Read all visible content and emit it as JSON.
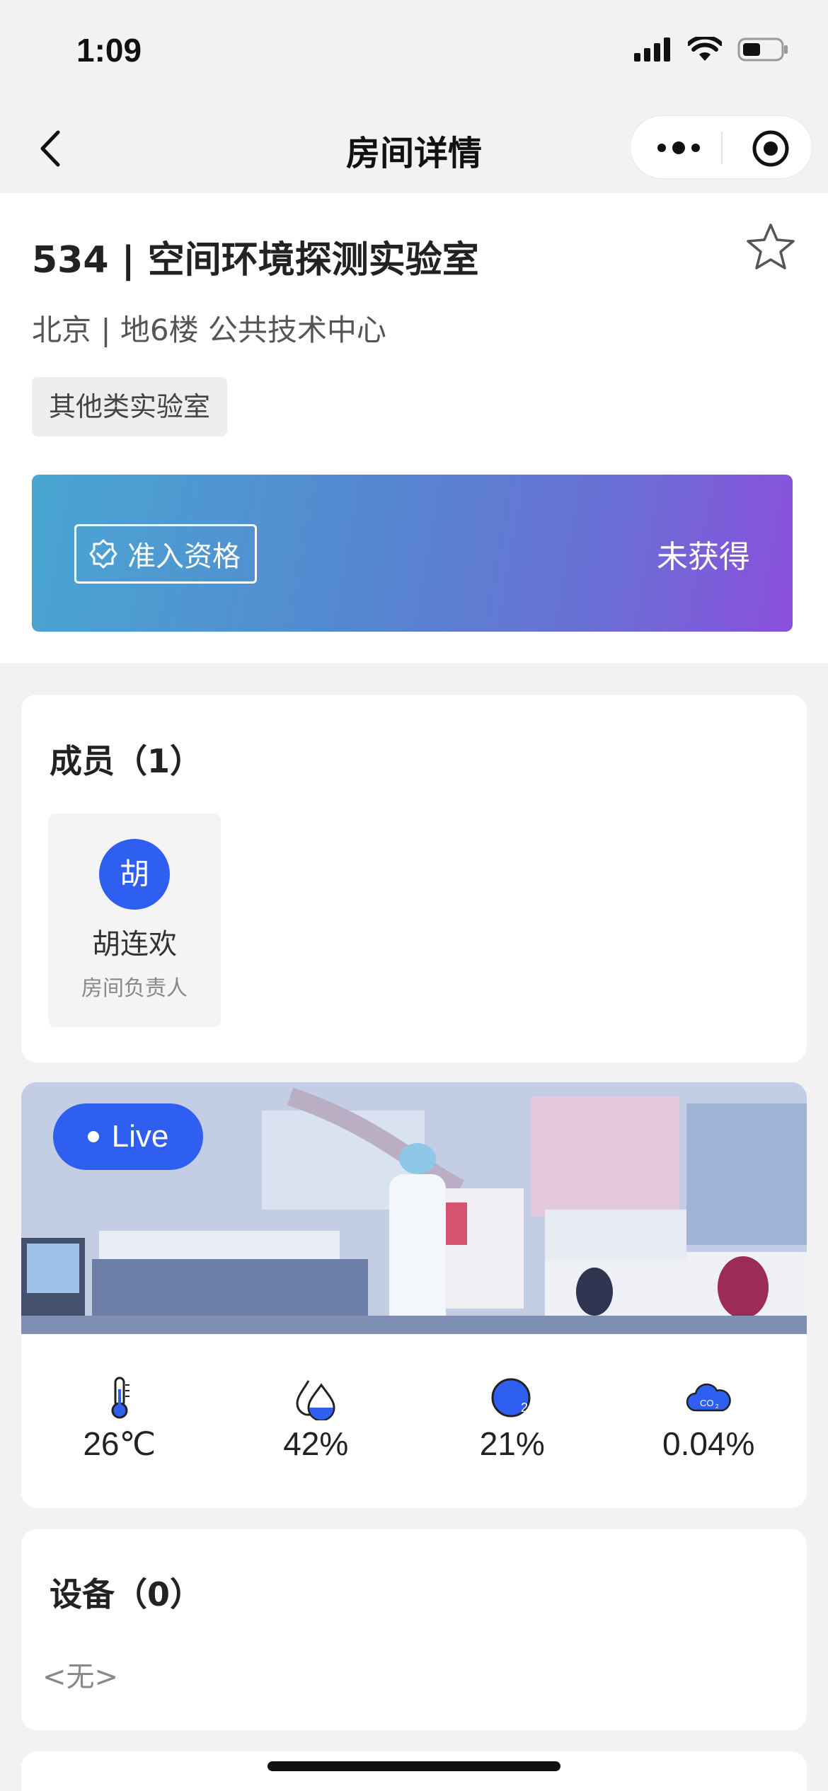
{
  "status_bar": {
    "time": "1:09"
  },
  "nav": {
    "title": "房间详情"
  },
  "room": {
    "title": "534 | 空间环境探测实验室",
    "location": "北京 | 地6楼   公共技术中心",
    "tag": "其他类实验室",
    "access": {
      "label": "准入资格",
      "status": "未获得"
    }
  },
  "members": {
    "title": "成员（1）",
    "items": [
      {
        "avatar_text": "胡",
        "name": "胡连欢",
        "role": "房间负责人"
      }
    ]
  },
  "environment": {
    "live_label": "Live",
    "metrics": [
      {
        "icon": "thermometer-icon",
        "value": "26℃"
      },
      {
        "icon": "humidity-icon",
        "value": "42%"
      },
      {
        "icon": "oxygen-icon",
        "value": "21%"
      },
      {
        "icon": "co2-icon",
        "value": "0.04%"
      }
    ]
  },
  "devices": {
    "title": "设备（0）",
    "empty_text": "<无>"
  },
  "colors": {
    "accent": "#2f5ff0",
    "banner_start": "#49a6d2",
    "banner_end": "#8b4fdc"
  }
}
